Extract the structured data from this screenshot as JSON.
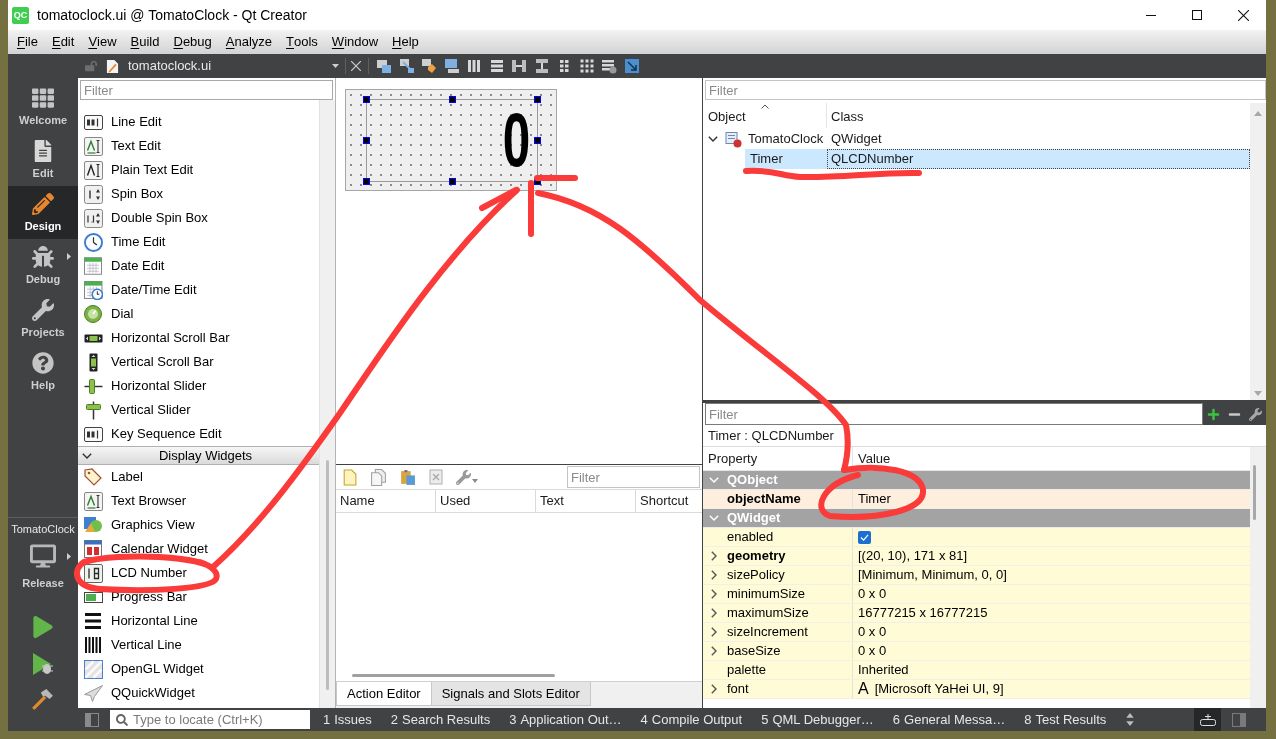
{
  "window": {
    "logo": "QC",
    "title": "tomatoclock.ui @ TomatoClock - Qt Creator"
  },
  "menu": [
    "File",
    "Edit",
    "View",
    "Build",
    "Debug",
    "Analyze",
    "Tools",
    "Window",
    "Help"
  ],
  "modes": [
    {
      "label": "Welcome",
      "kind": "welcome",
      "selected": false
    },
    {
      "label": "Edit",
      "kind": "edit",
      "selected": false
    },
    {
      "label": "Design",
      "kind": "design",
      "selected": true
    },
    {
      "label": "Debug",
      "kind": "debug",
      "selected": false
    },
    {
      "label": "Projects",
      "kind": "projects",
      "selected": false
    },
    {
      "label": "Help",
      "kind": "help",
      "selected": false
    }
  ],
  "kit": {
    "project": "TomatoClock",
    "build": "Release"
  },
  "editor_toolbar": {
    "file": "tomatoclock.ui"
  },
  "widget_box": {
    "filter": {
      "placeholder": "Filter"
    },
    "groups": [
      {
        "items": [
          {
            "label": "Line Edit",
            "kind": "lineedit"
          },
          {
            "label": "Text Edit",
            "kind": "textedit"
          },
          {
            "label": "Plain Text Edit",
            "kind": "plaintextedit"
          },
          {
            "label": "Spin Box",
            "kind": "spinbox"
          },
          {
            "label": "Double Spin Box",
            "kind": "doublespinbox"
          },
          {
            "label": "Time Edit",
            "kind": "timeedit"
          },
          {
            "label": "Date Edit",
            "kind": "dateedit"
          },
          {
            "label": "Date/Time Edit",
            "kind": "datetimeedit"
          },
          {
            "label": "Dial",
            "kind": "dial"
          },
          {
            "label": "Horizontal Scroll Bar",
            "kind": "hscrollbar"
          },
          {
            "label": "Vertical Scroll Bar",
            "kind": "vscrollbar"
          },
          {
            "label": "Horizontal Slider",
            "kind": "hslider"
          },
          {
            "label": "Vertical Slider",
            "kind": "vslider"
          },
          {
            "label": "Key Sequence Edit",
            "kind": "lineedit"
          }
        ]
      },
      {
        "label": "Display Widgets",
        "expanded": true,
        "items": [
          {
            "label": "Label",
            "kind": "label"
          },
          {
            "label": "Text Browser",
            "kind": "textedit"
          },
          {
            "label": "Graphics View",
            "kind": "graphicsview"
          },
          {
            "label": "Calendar Widget",
            "kind": "calendar"
          },
          {
            "label": "LCD Number",
            "kind": "lcdnumber"
          },
          {
            "label": "Progress Bar",
            "kind": "progressbar"
          },
          {
            "label": "Horizontal Line",
            "kind": "hline"
          },
          {
            "label": "Vertical Line",
            "kind": "vline"
          },
          {
            "label": "OpenGL Widget",
            "kind": "opengl"
          },
          {
            "label": "QQuickWidget",
            "kind": "quickwidget"
          }
        ]
      }
    ]
  },
  "form": {
    "widget": {
      "value": "0",
      "selected": true
    }
  },
  "action_editor": {
    "filter": {
      "placeholder": "Filter"
    },
    "columns": [
      "Name",
      "Used",
      "Text",
      "Shortcut"
    ],
    "tabs": [
      {
        "label": "Action Editor",
        "selected": true
      },
      {
        "label": "Signals and Slots Editor",
        "selected": false
      }
    ]
  },
  "object_inspector": {
    "filter": {
      "placeholder": "Filter"
    },
    "columns": [
      {
        "label": "Object",
        "sorted": true
      },
      {
        "label": "Class",
        "sorted": false
      }
    ],
    "rows": [
      {
        "object": "TomatoClock",
        "class": "QWidget",
        "kind": "form",
        "expanded": true,
        "selected": false,
        "children": [
          {
            "object": "Timer",
            "class": "QLCDNumber",
            "selected": true
          }
        ]
      }
    ]
  },
  "property_editor": {
    "filter": {
      "placeholder": "Filter"
    },
    "title": "Timer : QLCDNumber",
    "columns": [
      "Property",
      "Value"
    ],
    "groups": [
      {
        "name": "QObject",
        "expanded": true,
        "color": "#fdeedd",
        "properties": [
          {
            "name": "objectName",
            "kind": "text",
            "value": "Timer",
            "modified": true,
            "expandable": false
          }
        ]
      },
      {
        "name": "QWidget",
        "expanded": true,
        "color": "#fffbd7",
        "properties": [
          {
            "name": "enabled",
            "kind": "checkbox",
            "checked": true,
            "modified": false,
            "expandable": false
          },
          {
            "name": "geometry",
            "kind": "text",
            "value": "[(20, 10), 171 x 81]",
            "modified": true,
            "expandable": true
          },
          {
            "name": "sizePolicy",
            "kind": "text",
            "value": "[Minimum, Minimum, 0, 0]",
            "modified": false,
            "expandable": true
          },
          {
            "name": "minimumSize",
            "kind": "text",
            "value": "0 x 0",
            "modified": false,
            "expandable": true
          },
          {
            "name": "maximumSize",
            "kind": "text",
            "value": "16777215 x 16777215",
            "modified": false,
            "expandable": true
          },
          {
            "name": "sizeIncrement",
            "kind": "text",
            "value": "0 x 0",
            "modified": false,
            "expandable": true
          },
          {
            "name": "baseSize",
            "kind": "text",
            "value": "0 x 0",
            "modified": false,
            "expandable": true
          },
          {
            "name": "palette",
            "kind": "text",
            "value": "Inherited",
            "modified": false,
            "expandable": false
          },
          {
            "name": "font",
            "kind": "font",
            "sample": "A",
            "value": "[Microsoft YaHei UI, 9]",
            "modified": false,
            "expandable": true
          }
        ]
      }
    ]
  },
  "status_bar": {
    "locator": {
      "placeholder": "Type to locate (Ctrl+K)"
    },
    "panes": [
      {
        "number": "1",
        "label": "Issues"
      },
      {
        "number": "2",
        "label": "Search Results"
      },
      {
        "number": "3",
        "label": "Application Out…"
      },
      {
        "number": "4",
        "label": "Compile Output"
      },
      {
        "number": "5",
        "label": "QML Debugger…"
      },
      {
        "number": "6",
        "label": "General Messa…"
      },
      {
        "number": "8",
        "label": "Test Results"
      }
    ],
    "output_toggle": {
      "on": true
    }
  }
}
